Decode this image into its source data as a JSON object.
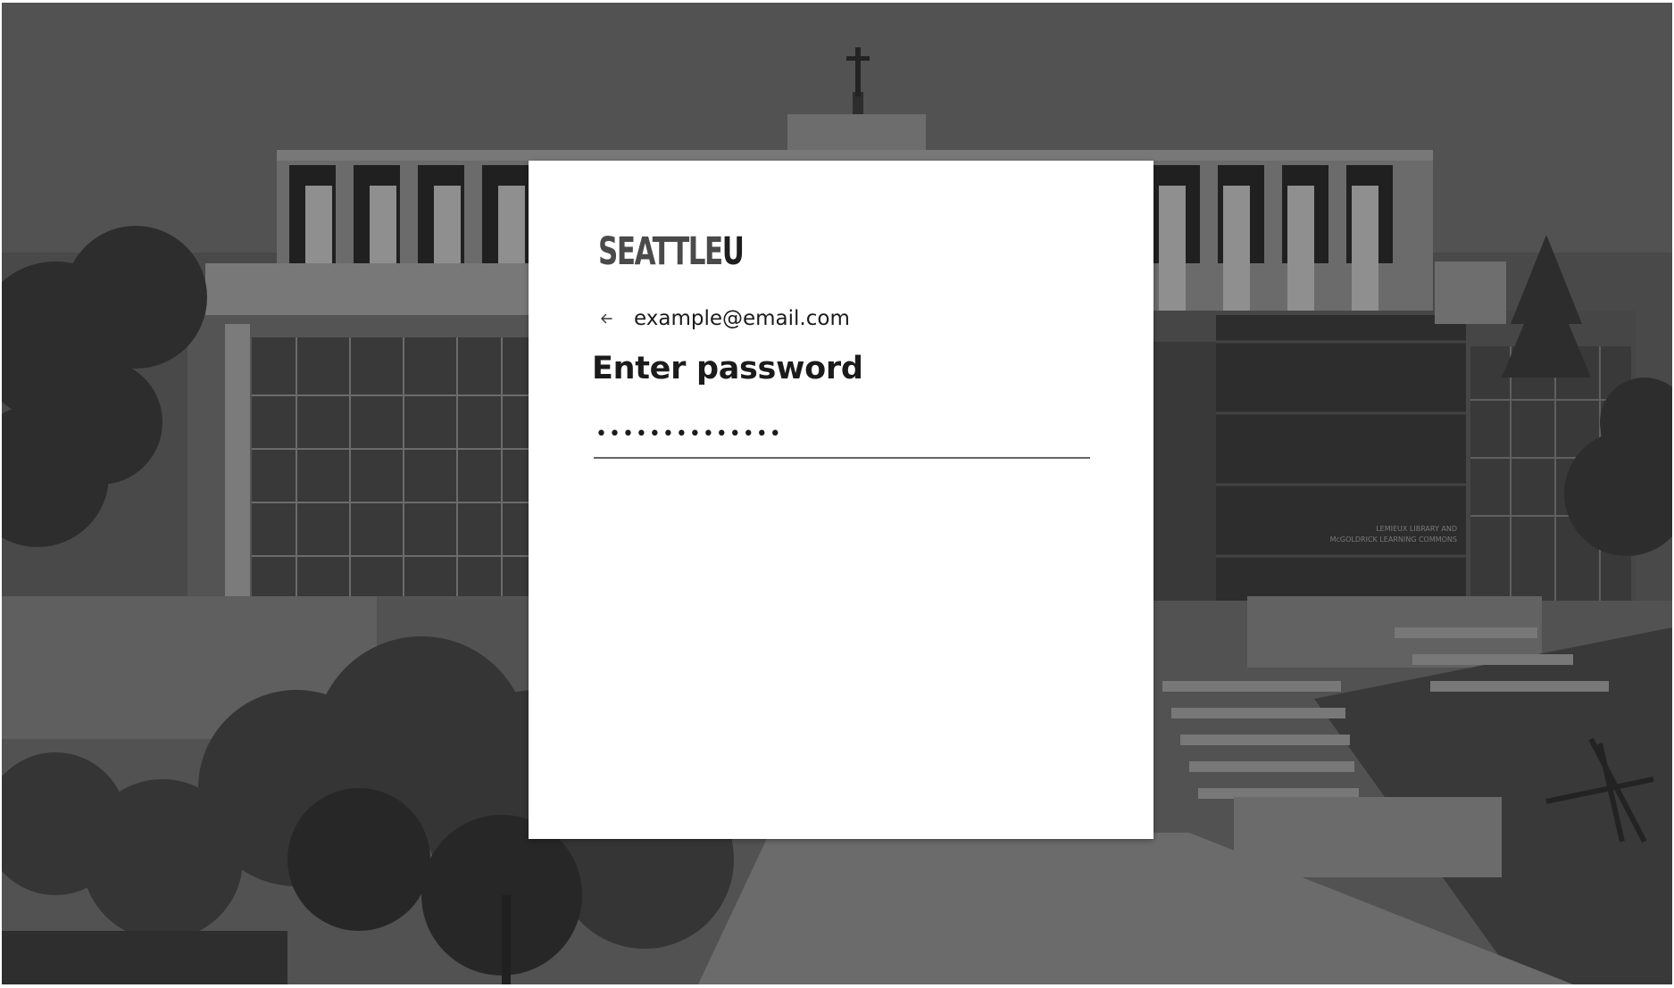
{
  "brand": {
    "logo_main": "SEATTLE",
    "logo_suffix": "U"
  },
  "identity": {
    "email": "example@email.com",
    "back_icon": "arrow-left-icon"
  },
  "title": "Enter password",
  "password": {
    "value": "••••••••••••••",
    "type": "password"
  },
  "background": {
    "building_sign_line1": "LEMIEUX LIBRARY AND",
    "building_sign_line2": "McGOLDRICK LEARNING COMMONS"
  },
  "colors": {
    "overlay": "#4d4d4d",
    "card": "#ffffff",
    "text": "#1b1b1b",
    "underline": "#666666"
  }
}
